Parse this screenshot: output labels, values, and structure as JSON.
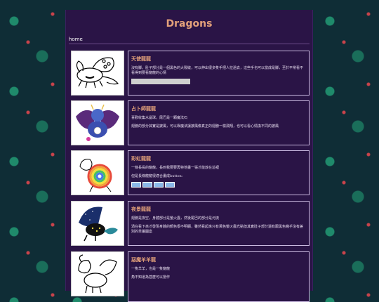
{
  "page": {
    "title": "Dragons"
  },
  "nav": {
    "home": "home"
  },
  "cards": [
    {
      "heading": "天使龍龍",
      "lines": [
        "沒有腳，肚子部分是一個黑色的大裂縫，可以伸出很多隻手把人拉過去，這些手也可以當成是腳，至於平常看不看得到要看龍龍的心情"
      ]
    },
    {
      "heading": "占卜師龍龍",
      "lines": [
        "喜歡收集水晶球，尾巴是一顆魔法石",
        "翅膀的部分其實是披風，可以靠魔法讓披風像真正的翅膀一樣飛翔，也可以看心情換不同的披風"
      ]
    },
    {
      "heading": "彩虹龍龍",
      "lines": [
        "一條長長的龍龍，長到我要要再特地畫一張才能放在這裡",
        "但是長條龍龍很適合畫成button:"
      ]
    },
    {
      "heading": "夜景龍龍",
      "lines": [
        "翅膀是夜空，身體部分是螢火蟲，然後尾巴的部分是河流",
        "渦在看下來才發現身體的顏色很不明顯，雖然看起來只有黃色螢火蟲光點但其實肚子部分還有跟黑色幾乎沒有差別的草叢圖案"
      ]
    },
    {
      "heading": "惡魔羊羊龍",
      "lines": [
        "一隻羊羊，也是一隻龍龍",
        "角不知道為甚麼可以當作"
      ]
    }
  ]
}
